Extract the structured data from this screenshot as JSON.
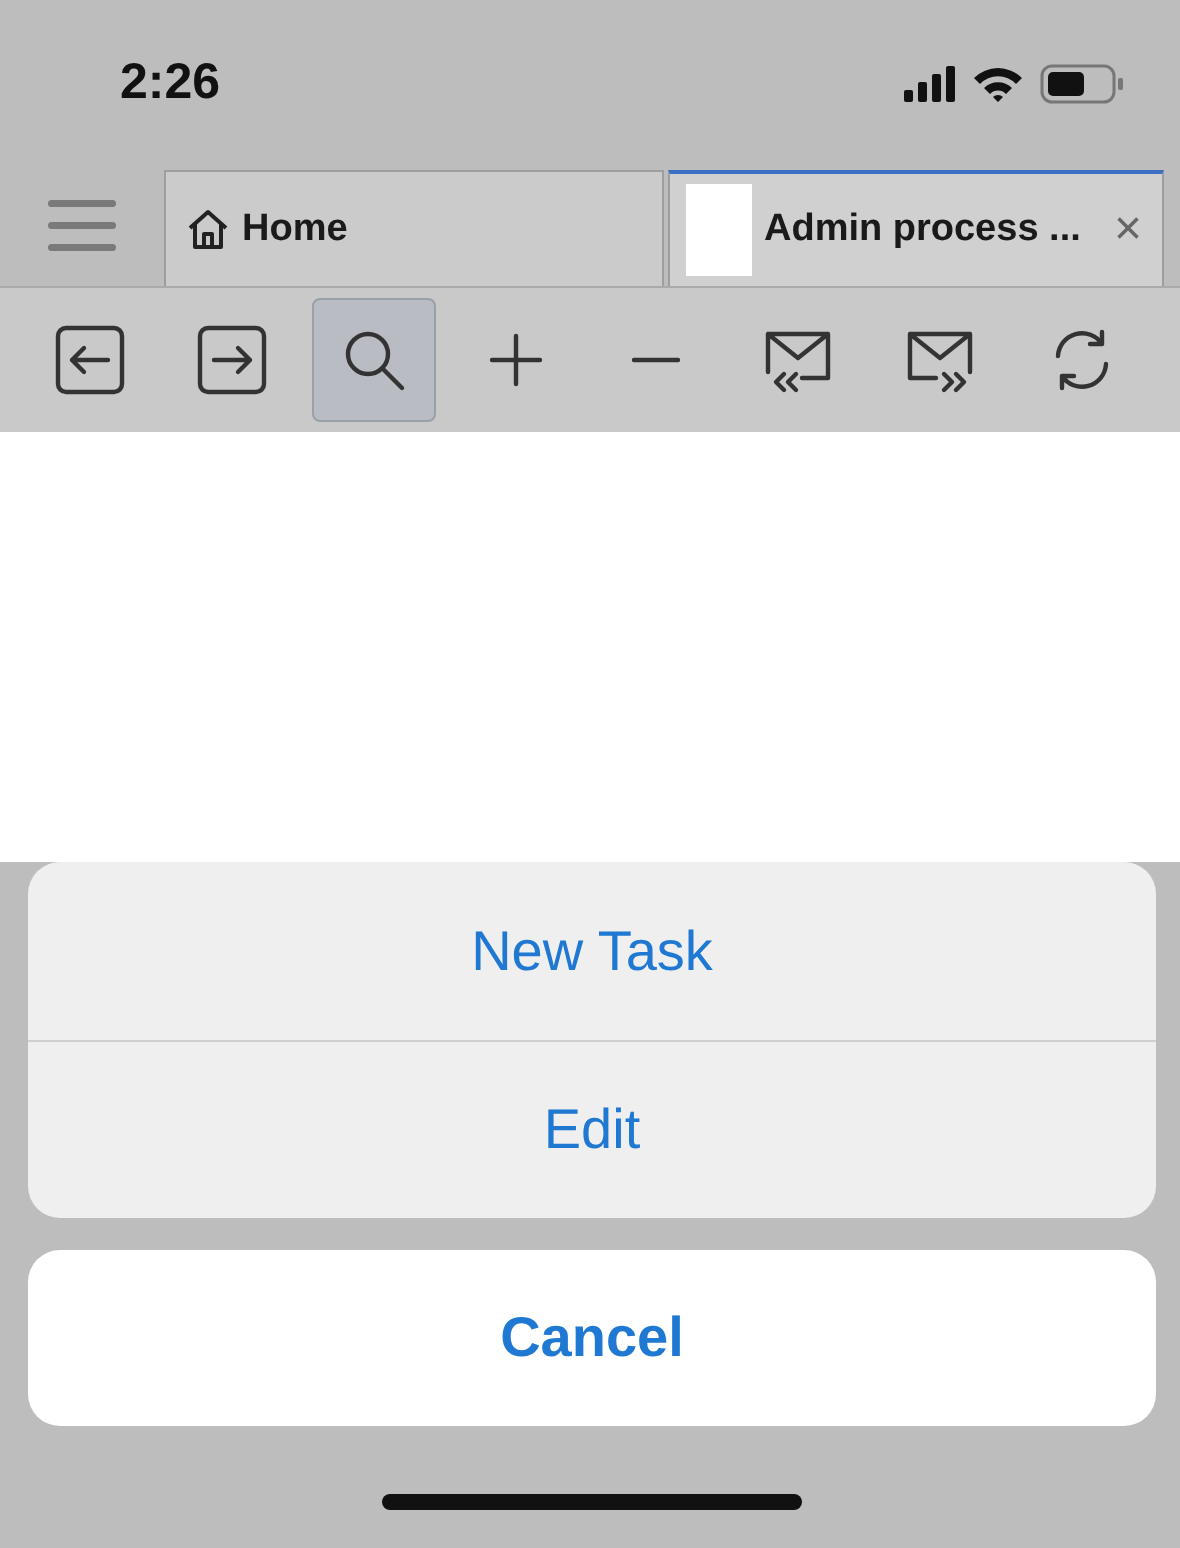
{
  "status_bar": {
    "time": "2:26"
  },
  "tabs": [
    {
      "label": "Home",
      "kind": "home",
      "selected": false
    },
    {
      "label": "Admin process ...",
      "kind": "page",
      "selected": true,
      "close": "×"
    }
  ],
  "toolbar": [
    {
      "kind": "back",
      "selected": false
    },
    {
      "kind": "forward",
      "selected": false
    },
    {
      "kind": "search",
      "selected": true
    },
    {
      "kind": "zoom-in",
      "selected": false
    },
    {
      "kind": "zoom-out",
      "selected": false
    },
    {
      "kind": "mail-in",
      "selected": false
    },
    {
      "kind": "mail-out",
      "selected": false
    },
    {
      "kind": "refresh",
      "selected": false
    }
  ],
  "action_sheet": {
    "actions": [
      "New Task",
      "Edit"
    ],
    "cancel": "Cancel"
  }
}
